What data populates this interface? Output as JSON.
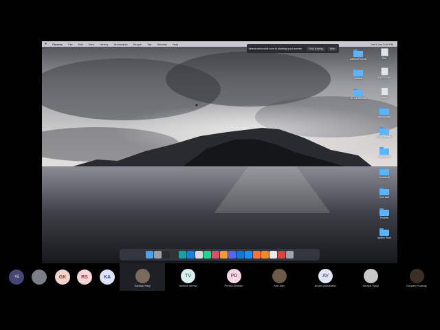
{
  "menubar": {
    "app_name": "Chrome",
    "items": [
      "File",
      "Edit",
      "View",
      "History",
      "Bookmarks",
      "People",
      "Tab",
      "Window",
      "Help"
    ],
    "clock": "Sat 8 Jan 3:40 PM"
  },
  "share_banner": {
    "text": "teams.microsoft.com is sharing your screen.",
    "stop_label": "Stop sharing",
    "hide_label": "Hide"
  },
  "desktop_icons": [
    {
      "label": "antennaProjects",
      "type": "folder"
    },
    {
      "label": "untitled",
      "type": "folder"
    },
    {
      "label": "Git repositories",
      "type": "folder"
    },
    {
      "label": "Disk",
      "type": "drive"
    },
    {
      "label": "BOOTCAMP",
      "type": "drive"
    },
    {
      "label": "clear",
      "type": "doc"
    },
    {
      "label": "pascal-class",
      "type": "folder"
    },
    {
      "label": "Cloud_website",
      "type": "folder"
    },
    {
      "label": "collegework",
      "type": "folder"
    },
    {
      "label": "homework",
      "type": "folder"
    },
    {
      "label": "Jove staff",
      "type": "folder"
    },
    {
      "label": "Projects",
      "type": "folder"
    },
    {
      "label": "Ignition Work",
      "type": "folder"
    }
  ],
  "dock_apps": [
    {
      "icon": "finder-icon",
      "color": "#4aa3f0"
    },
    {
      "icon": "preview-icon",
      "color": "#9aa0a8"
    },
    {
      "icon": "terminal-icon",
      "color": "#2a2a2a"
    },
    {
      "icon": "github-icon",
      "color": "#333333"
    },
    {
      "icon": "arduino-icon",
      "color": "#17a2a8"
    },
    {
      "icon": "sourcetree-icon",
      "color": "#1b7ee0"
    },
    {
      "icon": "bar-icon",
      "color": "#d6d8dc"
    },
    {
      "icon": "pycharm-icon",
      "color": "#21d789"
    },
    {
      "icon": "intellij-icon",
      "color": "#e14b6c"
    },
    {
      "icon": "sublime-icon",
      "color": "#f29b32"
    },
    {
      "icon": "discord-icon",
      "color": "#5865f2"
    },
    {
      "icon": "vscode-icon",
      "color": "#0b7ad1"
    },
    {
      "icon": "xcode-icon",
      "color": "#1f8ef1"
    },
    {
      "icon": "firefox-icon",
      "color": "#ff7139"
    },
    {
      "icon": "vlc-icon",
      "color": "#f08a24"
    },
    {
      "icon": "textedit-icon",
      "color": "#e8e8e8"
    },
    {
      "icon": "chrome-icon",
      "color": "#db4437"
    },
    {
      "icon": "trash-icon",
      "color": "#9fa4ab"
    }
  ],
  "participants": {
    "more_label": "+6",
    "small": [
      {
        "initials": "",
        "bg": "#7a7f86",
        "photo": true
      },
      {
        "initials": "GK",
        "bg": "#f1d3cc",
        "color": "#8a3a2e"
      },
      {
        "initials": "RS",
        "bg": "#f6d5d8",
        "color": "#a2323c"
      },
      {
        "initials": "KA",
        "bg": "#dfe3f7",
        "color": "#3a4aa0"
      }
    ],
    "tiles": [
      {
        "name": "Sarthak Negi",
        "initials": "",
        "bg": "#7a6b5c",
        "photo": true,
        "active": true
      },
      {
        "name": "Tanisha Verma",
        "initials": "TV",
        "bg": "#d9f0ec",
        "photo": false,
        "active": false
      },
      {
        "name": "Prerna Dhiman",
        "initials": "PD",
        "bg": "#f6d5e4",
        "photo": false,
        "active": false
      },
      {
        "name": "Kriti Jain",
        "initials": "",
        "bg": "#6b5a48",
        "photo": true,
        "active": false
      },
      {
        "name": "Arush Vashishtha",
        "initials": "AV",
        "bg": "#e1e3f6",
        "photo": false,
        "active": false
      },
      {
        "name": "Shreya Tyagi",
        "initials": "",
        "bg": "#c8c8c8",
        "photo": true,
        "active": false
      },
      {
        "name": "Dorwek Pourkap",
        "initials": "",
        "bg": "#3a3026",
        "photo": true,
        "active": false
      }
    ]
  }
}
